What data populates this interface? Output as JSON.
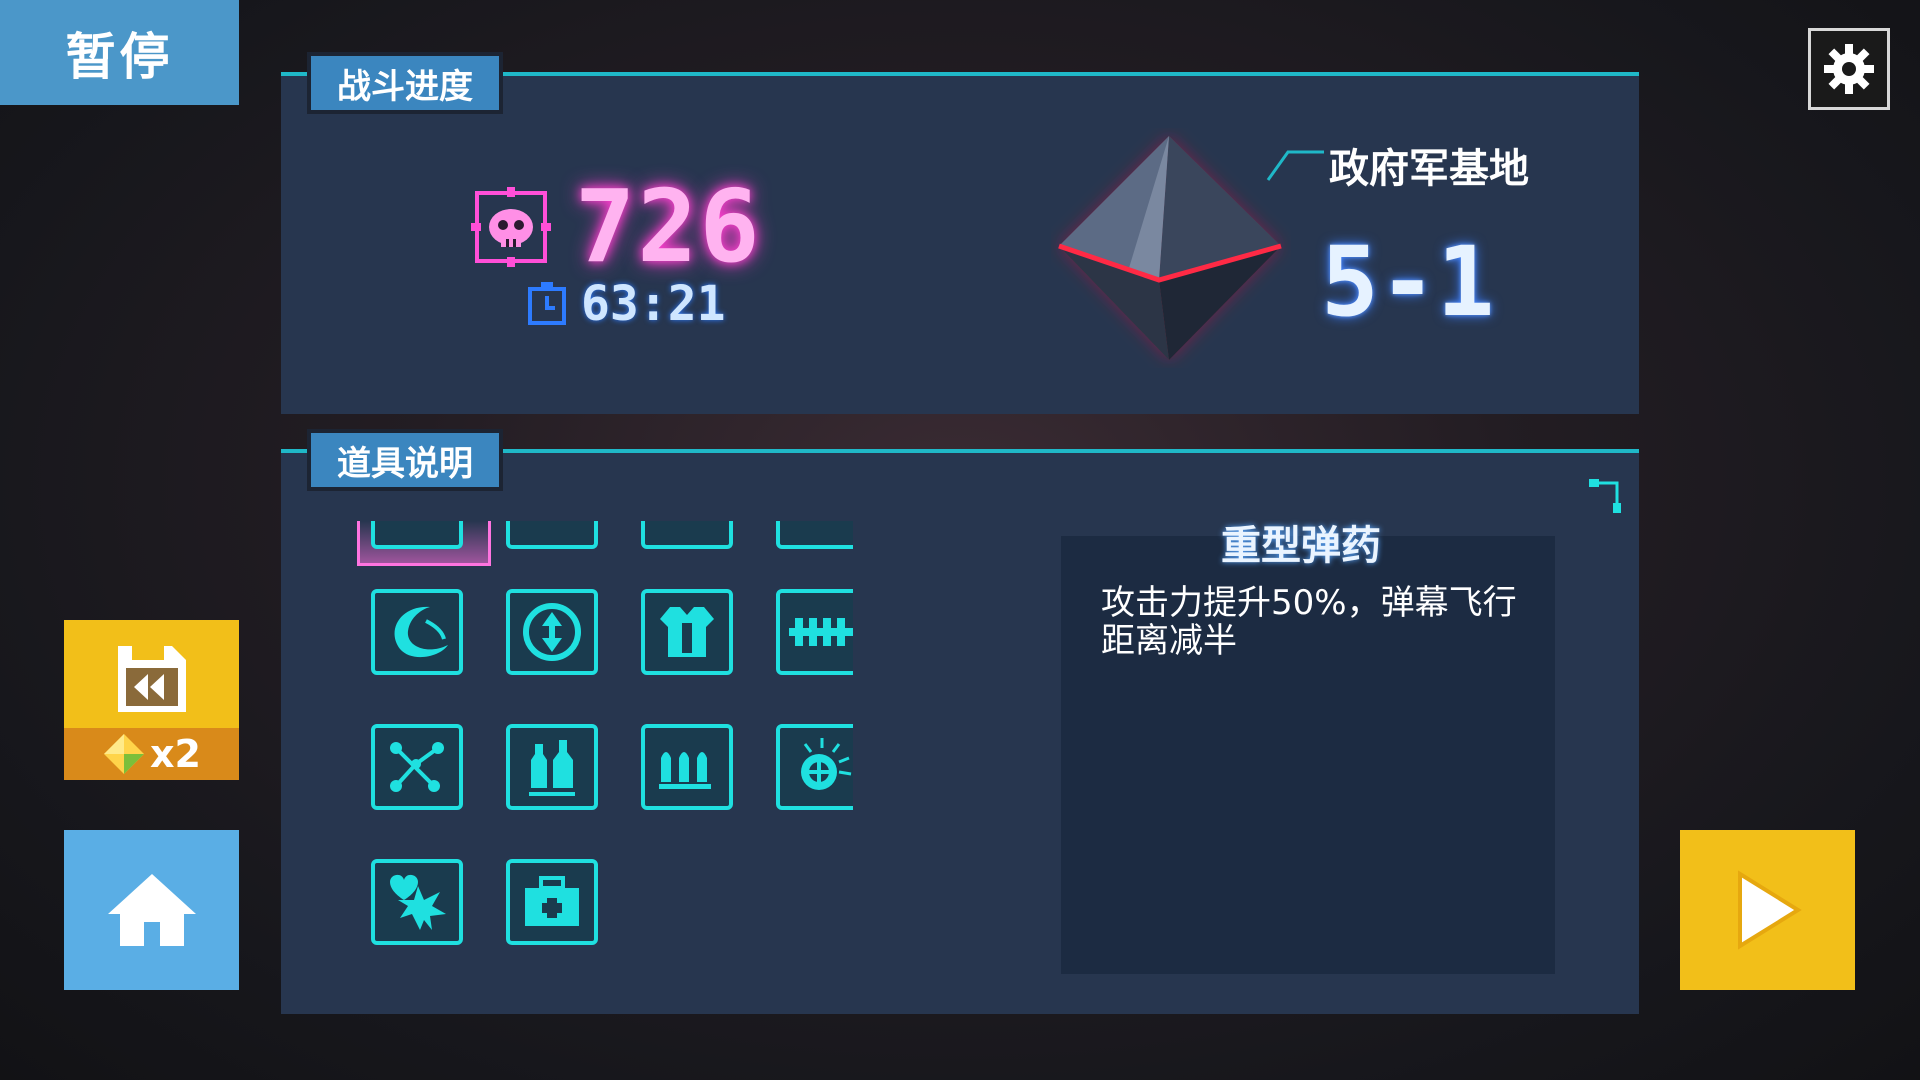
{
  "header": {
    "pause_label": "暂停"
  },
  "battle_panel": {
    "tab_label": "战斗进度",
    "kill_count": "726",
    "elapsed_time": "63:21",
    "location_name": "政府军基地",
    "stage": "5-1"
  },
  "items_panel": {
    "tab_label": "道具说明",
    "selected_item": {
      "name": "重型弹药",
      "description": "攻击力提升50%，弹幕飞行距离减半"
    },
    "items": [
      {
        "icon": "partial-item-1-icon"
      },
      {
        "icon": "partial-item-2-icon"
      },
      {
        "icon": "partial-item-3-icon"
      },
      {
        "icon": "partial-item-4-icon"
      },
      {
        "icon": "partial-item-5-icon"
      },
      {
        "icon": "crescent-wave-icon"
      },
      {
        "icon": "up-down-arrow-icon"
      },
      {
        "icon": "armor-vest-icon"
      },
      {
        "icon": "ammo-belt-icon"
      },
      {
        "icon": "magnet-icon"
      },
      {
        "icon": "network-nodes-icon"
      },
      {
        "icon": "bottles-icon"
      },
      {
        "icon": "bullets-icon"
      },
      {
        "icon": "crosshair-burst-icon"
      },
      {
        "icon": "flame-badge-icon"
      },
      {
        "icon": "heart-explosion-icon"
      },
      {
        "icon": "medkit-icon"
      }
    ]
  },
  "rewind": {
    "multiplier": "x2"
  },
  "colors": {
    "accent": "#1fe0e0",
    "tab": "#3b86bf",
    "panel": "#27364f",
    "kill_glow": "#ff3fd0",
    "gold": "#f2bf19"
  }
}
